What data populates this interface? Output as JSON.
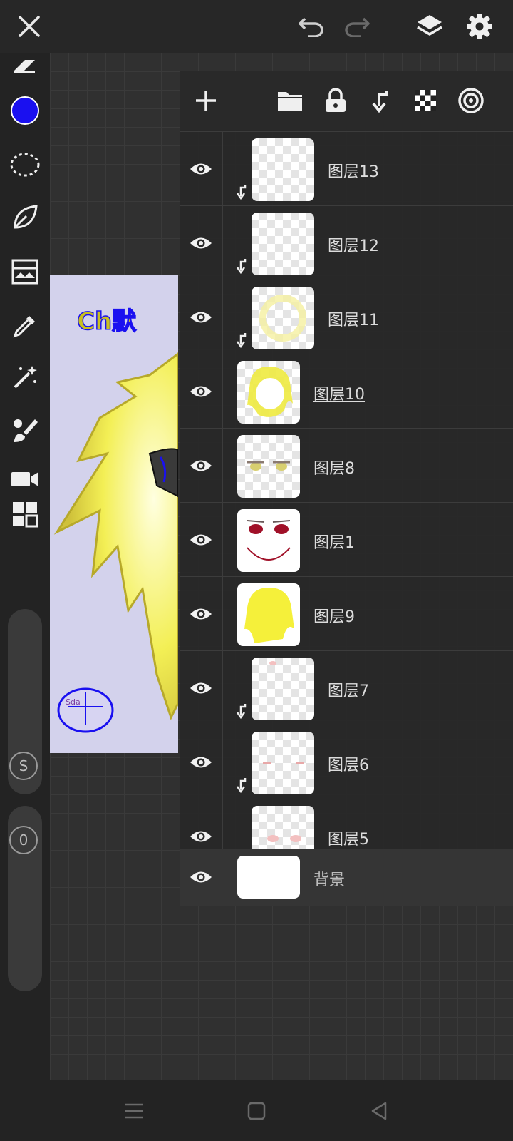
{
  "topbar": {
    "close_icon": "close-icon",
    "undo_icon": "undo-icon",
    "redo_icon": "redo-icon",
    "layers_icon": "layers-icon",
    "settings_icon": "gear-icon"
  },
  "colors": {
    "current_brush": "#1a10f0",
    "panel_bg": "#282828",
    "hair_yellow": "#f4f050"
  },
  "left_toolbar": {
    "tools": [
      "eraser-icon",
      "color-swatch",
      "lasso-icon",
      "leaf-brush-icon",
      "image-icon",
      "eyedropper-icon",
      "magic-wand-icon",
      "fill-brush-icon",
      "video-icon",
      "panels-icon"
    ],
    "size_slider_label": "S",
    "opacity_slider_label": "0"
  },
  "layers_toolbar": {
    "add_icon": "plus-icon",
    "folder_icon": "folder-icon",
    "lock_icon": "lock-icon",
    "clip_icon": "clip-arrow-icon",
    "transparency_icon": "checker-icon",
    "blend_icon": "target-icon"
  },
  "layers": [
    {
      "name": "图层13",
      "clipped": true,
      "active": false
    },
    {
      "name": "图层12",
      "clipped": true,
      "active": false
    },
    {
      "name": "图层11",
      "clipped": true,
      "active": false
    },
    {
      "name": "图层10",
      "clipped": false,
      "active": true
    },
    {
      "name": "图层8",
      "clipped": false,
      "active": false
    },
    {
      "name": "图层1",
      "clipped": false,
      "active": false
    },
    {
      "name": "图层9",
      "clipped": false,
      "active": false
    },
    {
      "name": "图层7",
      "clipped": true,
      "active": false
    },
    {
      "name": "图层6",
      "clipped": true,
      "active": false
    },
    {
      "name": "图层5",
      "clipped": true,
      "active": false
    }
  ],
  "background_layer": {
    "name": "背景"
  },
  "artwork": {
    "title_text": "Ch默",
    "signature": "Sda"
  },
  "navbar": {
    "menu_icon": "menu-icon",
    "home_icon": "home-icon",
    "back_icon": "back-icon"
  }
}
